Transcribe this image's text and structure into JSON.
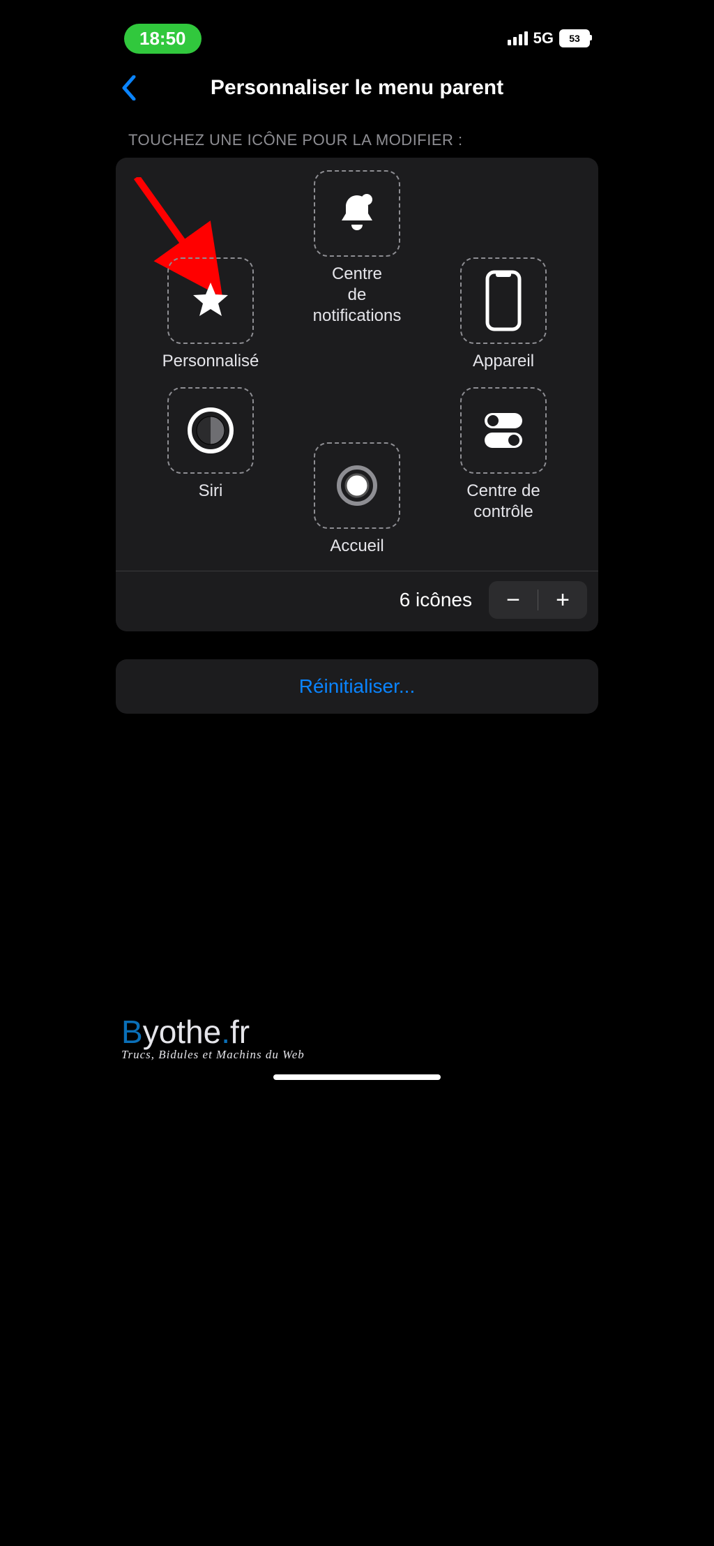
{
  "status": {
    "time": "18:50",
    "network": "5G",
    "battery_pct": "53"
  },
  "nav": {
    "title": "Personnaliser le menu parent"
  },
  "section_hint": "TOUCHEZ UNE ICÔNE POUR LA MODIFIER :",
  "icons": {
    "notifications": "Centre\nde notifications",
    "custom": "Personnalisé",
    "device": "Appareil",
    "siri": "Siri",
    "control_center": "Centre de\ncontrôle",
    "home": "Accueil"
  },
  "footer": {
    "count_label": "6 icônes"
  },
  "reset_label": "Réinitialiser...",
  "watermark": {
    "brand": "Byothe.fr",
    "tagline": "Trucs, Bidules et Machins du Web"
  }
}
